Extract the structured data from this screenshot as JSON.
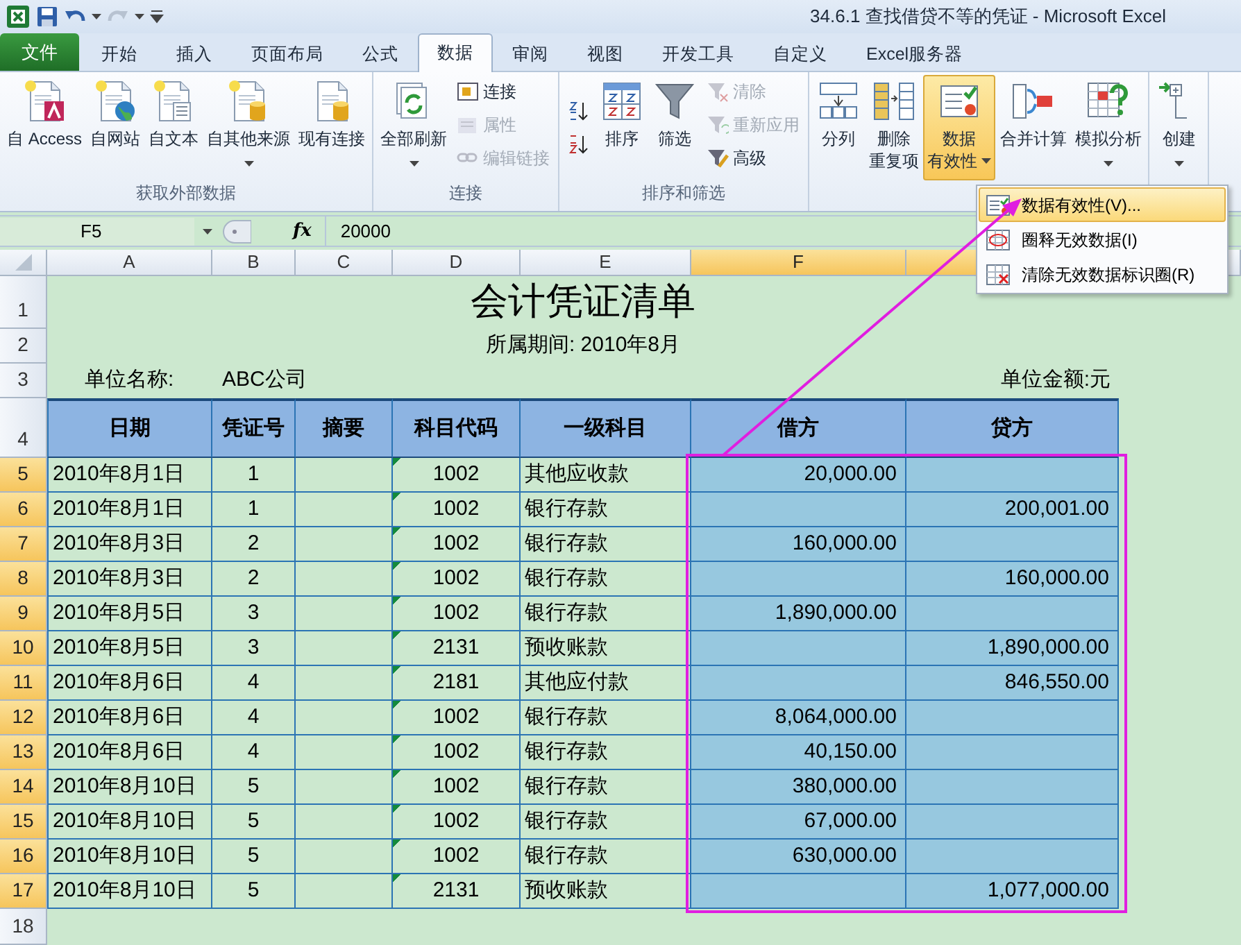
{
  "window": {
    "title": "34.6.1 查找借贷不等的凭证  -  Microsoft Excel"
  },
  "file_tab": "文件",
  "tabs": [
    {
      "label": "开始",
      "selected": false
    },
    {
      "label": "插入",
      "selected": false
    },
    {
      "label": "页面布局",
      "selected": false
    },
    {
      "label": "公式",
      "selected": false
    },
    {
      "label": "数据",
      "selected": true
    },
    {
      "label": "审阅",
      "selected": false
    },
    {
      "label": "视图",
      "selected": false
    },
    {
      "label": "开发工具",
      "selected": false
    },
    {
      "label": "自定义",
      "selected": false
    },
    {
      "label": "Excel服务器",
      "selected": false
    }
  ],
  "ribbon": {
    "groups": [
      {
        "label": "获取外部数据",
        "columns": [
          [
            {
              "kind": "large",
              "label": "自 Access",
              "disabled": false
            }
          ],
          [
            {
              "kind": "large",
              "label": "自网站",
              "disabled": false
            }
          ],
          [
            {
              "kind": "large",
              "label": "自文本",
              "disabled": false
            }
          ],
          [
            {
              "kind": "large",
              "label": "自其他来源",
              "disabled": false,
              "has_menu": true,
              "expanded": false
            }
          ],
          [
            {
              "kind": "large",
              "label": "现有连接",
              "disabled": false
            }
          ]
        ]
      },
      {
        "label": "连接",
        "columns": [
          [
            {
              "kind": "large",
              "label": "全部刷新",
              "disabled": false,
              "has_menu": true,
              "expanded": false
            }
          ],
          [
            {
              "kind": "small",
              "label": "连接",
              "disabled": false
            },
            {
              "kind": "small",
              "label": "属性",
              "disabled": true
            },
            {
              "kind": "small",
              "label": "编辑链接",
              "disabled": true
            }
          ]
        ]
      },
      {
        "label": "排序和筛选",
        "columns": [
          [
            {
              "kind": "icon",
              "disabled": false
            },
            {
              "kind": "icon",
              "disabled": false
            }
          ],
          [
            {
              "kind": "large",
              "label": "排序",
              "disabled": false
            }
          ],
          [
            {
              "kind": "large",
              "label": "筛选",
              "disabled": false
            }
          ],
          [
            {
              "kind": "small",
              "label": "清除",
              "disabled": true
            },
            {
              "kind": "small",
              "label": "重新应用",
              "disabled": true
            },
            {
              "kind": "small",
              "label": "高级",
              "disabled": false
            }
          ]
        ]
      },
      {
        "columns": [
          [
            {
              "kind": "large",
              "label": "分列",
              "disabled": false
            }
          ],
          [
            {
              "kind": "large",
              "label_lines": [
                "删除",
                "重复项"
              ],
              "disabled": false
            }
          ],
          [
            {
              "kind": "large",
              "label_lines": [
                "数据",
                "有效性"
              ],
              "disabled": false,
              "has_menu": true,
              "expanded": true
            }
          ],
          [
            {
              "kind": "large",
              "label": "合并计算",
              "disabled": false
            }
          ],
          [
            {
              "kind": "large",
              "label": "模拟分析",
              "disabled": false,
              "has_menu": true,
              "expanded": false
            }
          ]
        ]
      },
      {
        "columns": [
          [
            {
              "kind": "large",
              "label": "创建",
              "disabled": false,
              "has_menu": true,
              "expanded": false
            }
          ]
        ]
      }
    ]
  },
  "dropdown_menu": {
    "items": [
      {
        "label": "数据有效性(V)...",
        "selected": true
      },
      {
        "label": "圈释无效数据(I)",
        "selected": false
      },
      {
        "label": "清除无效数据标识圈(R)",
        "selected": false
      }
    ]
  },
  "formula_bar": {
    "name_box": "F5",
    "function_label": "fx",
    "value": "20000"
  },
  "sheet": {
    "columns": [
      {
        "label": "A",
        "selected": false
      },
      {
        "label": "B",
        "selected": false
      },
      {
        "label": "C",
        "selected": false
      },
      {
        "label": "D",
        "selected": false
      },
      {
        "label": "E",
        "selected": false
      },
      {
        "label": "F",
        "selected": true
      },
      {
        "selected": true
      },
      {
        "selected": false
      }
    ],
    "row_numbers": [
      {
        "label": "1",
        "selected": false
      },
      {
        "label": "2",
        "selected": false
      },
      {
        "label": "3",
        "selected": false
      },
      {
        "label": "4",
        "selected": false
      },
      {
        "label": "5",
        "selected": true
      },
      {
        "label": "6",
        "selected": true
      },
      {
        "label": "7",
        "selected": true
      },
      {
        "label": "8",
        "selected": true
      },
      {
        "label": "9",
        "selected": true
      },
      {
        "label": "10",
        "selected": true
      },
      {
        "label": "11",
        "selected": true
      },
      {
        "label": "12",
        "selected": true
      },
      {
        "label": "13",
        "selected": true
      },
      {
        "label": "14",
        "selected": true
      },
      {
        "label": "15",
        "selected": true
      },
      {
        "label": "16",
        "selected": true
      },
      {
        "label": "17",
        "selected": true
      },
      {
        "label": "18",
        "selected": false
      }
    ],
    "title": "会计凭证清单",
    "period": "所属期间: 2010年8月",
    "unit_name_label": "单位名称:",
    "unit_name": "ABC公司",
    "amount_unit": "单位金额:元",
    "table": {
      "columns": [
        "日期",
        "凭证号",
        "摘要",
        "科目代码",
        "一级科目",
        "借方",
        "贷方"
      ],
      "rows": [
        {
          "date": "2010年8月1日",
          "voucher_no": "1",
          "code": "1002",
          "code_flagged": true,
          "account": "其他应收款",
          "debit": "20,000.00"
        },
        {
          "date": "2010年8月1日",
          "voucher_no": "1",
          "code": "1002",
          "code_flagged": true,
          "account": "银行存款",
          "credit": "200,001.00"
        },
        {
          "date": "2010年8月3日",
          "voucher_no": "2",
          "code": "1002",
          "code_flagged": true,
          "account": "银行存款",
          "debit": "160,000.00"
        },
        {
          "date": "2010年8月3日",
          "voucher_no": "2",
          "code": "1002",
          "code_flagged": true,
          "account": "银行存款",
          "credit": "160,000.00"
        },
        {
          "date": "2010年8月5日",
          "voucher_no": "3",
          "code": "1002",
          "code_flagged": true,
          "account": "银行存款",
          "debit": "1,890,000.00"
        },
        {
          "date": "2010年8月5日",
          "voucher_no": "3",
          "code": "2131",
          "code_flagged": true,
          "account": "预收账款",
          "credit": "1,890,000.00"
        },
        {
          "date": "2010年8月6日",
          "voucher_no": "4",
          "code": "2181",
          "code_flagged": true,
          "account": "其他应付款",
          "credit": "846,550.00"
        },
        {
          "date": "2010年8月6日",
          "voucher_no": "4",
          "code": "1002",
          "code_flagged": true,
          "account": "银行存款",
          "debit": "8,064,000.00"
        },
        {
          "date": "2010年8月6日",
          "voucher_no": "4",
          "code": "1002",
          "code_flagged": true,
          "account": "银行存款",
          "debit": "40,150.00"
        },
        {
          "date": "2010年8月10日",
          "voucher_no": "5",
          "code": "1002",
          "code_flagged": true,
          "account": "银行存款",
          "debit": "380,000.00"
        },
        {
          "date": "2010年8月10日",
          "voucher_no": "5",
          "code": "1002",
          "code_flagged": true,
          "account": "银行存款",
          "debit": "67,000.00"
        },
        {
          "date": "2010年8月10日",
          "voucher_no": "5",
          "code": "1002",
          "code_flagged": true,
          "account": "银行存款",
          "debit": "630,000.00"
        },
        {
          "date": "2010年8月10日",
          "voucher_no": "5",
          "code": "2131",
          "code_flagged": true,
          "account": "预收账款",
          "credit": "1,077,000.00"
        }
      ]
    }
  }
}
